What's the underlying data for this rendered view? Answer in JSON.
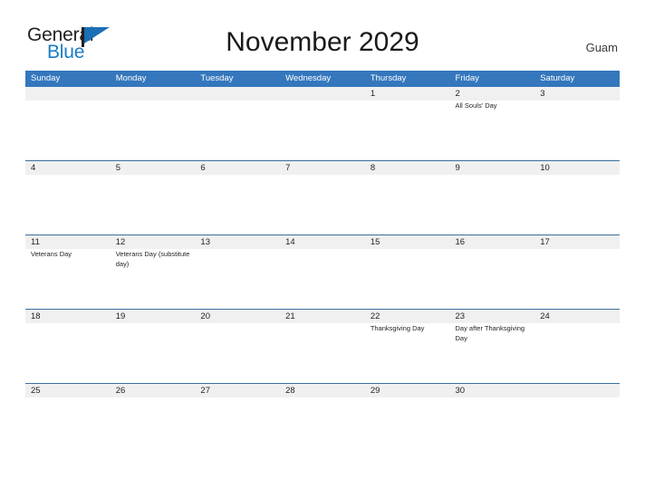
{
  "brand": {
    "name_part1": "General",
    "name_part2": "Blue",
    "flag_icon": "flag-triangle-icon",
    "accent_color": "#1a6fb5"
  },
  "header": {
    "title": "November 2029",
    "location": "Guam"
  },
  "calendar": {
    "header_bg": "#3477bd",
    "band_bg": "#f0f0f0",
    "rule_color": "#3a6f9e",
    "weekdays": [
      "Sunday",
      "Monday",
      "Tuesday",
      "Wednesday",
      "Thursday",
      "Friday",
      "Saturday"
    ],
    "weeks": [
      [
        {
          "date": "",
          "events": []
        },
        {
          "date": "",
          "events": []
        },
        {
          "date": "",
          "events": []
        },
        {
          "date": "",
          "events": []
        },
        {
          "date": "1",
          "events": []
        },
        {
          "date": "2",
          "events": [
            "All Souls' Day"
          ]
        },
        {
          "date": "3",
          "events": []
        }
      ],
      [
        {
          "date": "4",
          "events": []
        },
        {
          "date": "5",
          "events": []
        },
        {
          "date": "6",
          "events": []
        },
        {
          "date": "7",
          "events": []
        },
        {
          "date": "8",
          "events": []
        },
        {
          "date": "9",
          "events": []
        },
        {
          "date": "10",
          "events": []
        }
      ],
      [
        {
          "date": "11",
          "events": [
            "Veterans Day"
          ]
        },
        {
          "date": "12",
          "events": [
            "Veterans Day (substitute day)"
          ]
        },
        {
          "date": "13",
          "events": []
        },
        {
          "date": "14",
          "events": []
        },
        {
          "date": "15",
          "events": []
        },
        {
          "date": "16",
          "events": []
        },
        {
          "date": "17",
          "events": []
        }
      ],
      [
        {
          "date": "18",
          "events": []
        },
        {
          "date": "19",
          "events": []
        },
        {
          "date": "20",
          "events": []
        },
        {
          "date": "21",
          "events": []
        },
        {
          "date": "22",
          "events": [
            "Thanksgiving Day"
          ]
        },
        {
          "date": "23",
          "events": [
            "Day after Thanksgiving Day"
          ]
        },
        {
          "date": "24",
          "events": []
        }
      ],
      [
        {
          "date": "25",
          "events": []
        },
        {
          "date": "26",
          "events": []
        },
        {
          "date": "27",
          "events": []
        },
        {
          "date": "28",
          "events": []
        },
        {
          "date": "29",
          "events": []
        },
        {
          "date": "30",
          "events": []
        },
        {
          "date": "",
          "events": []
        }
      ]
    ]
  }
}
